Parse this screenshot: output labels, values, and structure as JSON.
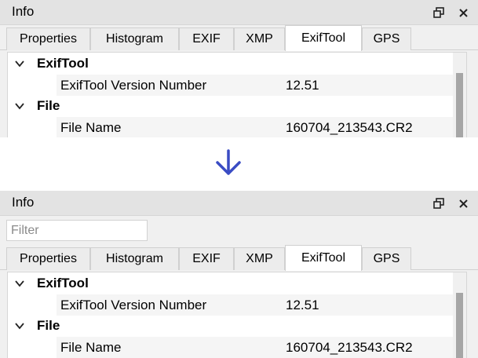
{
  "top_panel": {
    "title": "Info",
    "tabs": [
      {
        "label": "Properties",
        "active": false
      },
      {
        "label": "Histogram",
        "active": false
      },
      {
        "label": "EXIF",
        "active": false
      },
      {
        "label": "XMP",
        "active": false
      },
      {
        "label": "ExifTool",
        "active": true
      },
      {
        "label": "GPS",
        "active": false
      }
    ],
    "tree": {
      "groups": [
        {
          "label": "ExifTool",
          "expanded": true,
          "rows": [
            {
              "key": "ExifTool Version Number",
              "value": "12.51"
            }
          ]
        },
        {
          "label": "File",
          "expanded": true,
          "rows": [
            {
              "key": "File Name",
              "value": "160704_213543.CR2"
            }
          ]
        }
      ]
    }
  },
  "arrow_icon": "arrow-down-icon",
  "bottom_panel": {
    "title": "Info",
    "filter": {
      "placeholder": "Filter",
      "value": ""
    },
    "tabs": [
      {
        "label": "Properties",
        "active": false
      },
      {
        "label": "Histogram",
        "active": false
      },
      {
        "label": "EXIF",
        "active": false
      },
      {
        "label": "XMP",
        "active": false
      },
      {
        "label": "ExifTool",
        "active": true
      },
      {
        "label": "GPS",
        "active": false
      }
    ],
    "tree": {
      "groups": [
        {
          "label": "ExifTool",
          "expanded": true,
          "rows": [
            {
              "key": "ExifTool Version Number",
              "value": "12.51"
            }
          ]
        },
        {
          "label": "File",
          "expanded": true,
          "rows": [
            {
              "key": "File Name",
              "value": "160704_213543.CR2"
            }
          ]
        }
      ]
    }
  },
  "colors": {
    "arrow": "#3a4cc4",
    "titlebar": "#e3e3e3",
    "active_tab": "#ffffff"
  }
}
